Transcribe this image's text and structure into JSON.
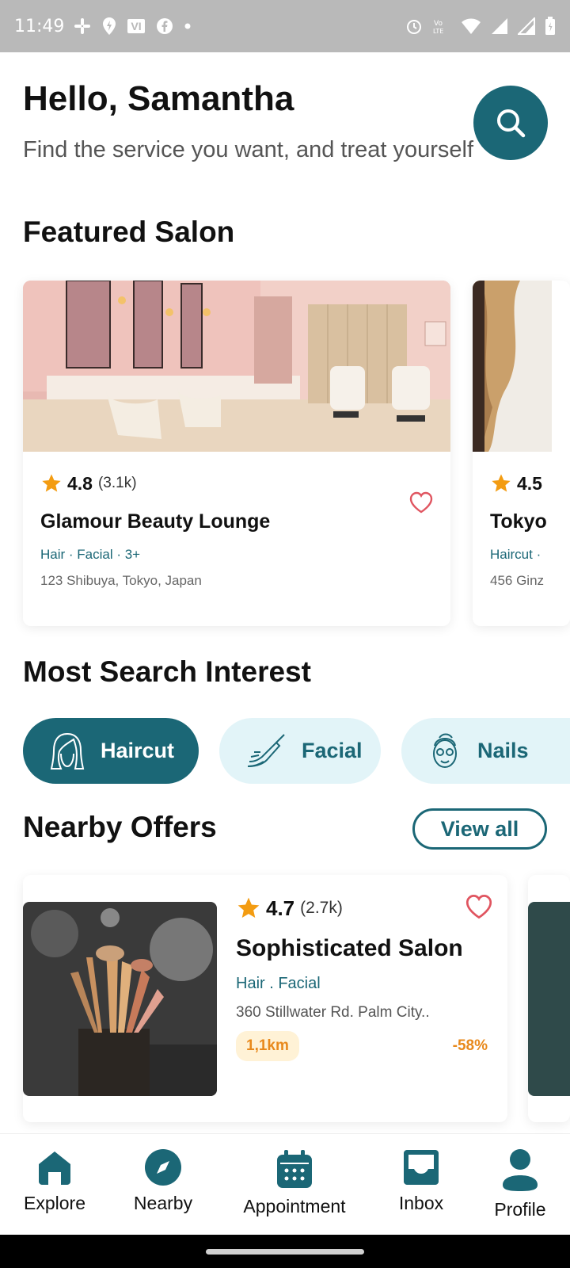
{
  "status_bar": {
    "time": "11:49",
    "left_icons": [
      "slack-icon",
      "location-icon",
      "vi-icon",
      "facebook-icon",
      "dot-icon"
    ],
    "vi_label": "VI",
    "right_icons": [
      "alarm-icon",
      "volte-icon",
      "wifi-icon",
      "signal-icon",
      "signal-icon",
      "battery-icon"
    ]
  },
  "header": {
    "greeting": "Hello, Samantha",
    "subtitle": "Find the service you want, and treat yourself",
    "search_icon": "search-icon"
  },
  "featured": {
    "title": "Featured Salon",
    "cards": [
      {
        "rating": "4.8",
        "count": "(3.1k)",
        "name": "Glamour Beauty Lounge",
        "tags": "Hair · Facial · 3+",
        "address": "123 Shibuya, Tokyo, Japan"
      },
      {
        "rating": "4.5",
        "name": "Tokyo",
        "tags": "Haircut ·",
        "address": "456 Ginz"
      }
    ]
  },
  "interest": {
    "title": "Most Search Interest",
    "chips": [
      {
        "label": "Haircut",
        "icon": "haircut-icon",
        "active": true
      },
      {
        "label": "Facial",
        "icon": "facial-icon",
        "active": false
      },
      {
        "label": "Nails",
        "icon": "nails-icon",
        "active": false
      }
    ]
  },
  "nearby": {
    "title": "Nearby Offers",
    "view_all": "View all",
    "offer": {
      "rating": "4.7",
      "count": "(2.7k)",
      "name": "Sophisticated Salon",
      "tags": "Hair . Facial",
      "address": "360 Stillwater Rd. Palm City..",
      "distance": "1,1km",
      "discount": "-58%"
    }
  },
  "nav": {
    "items": [
      {
        "label": "Explore",
        "icon": "home-icon"
      },
      {
        "label": "Nearby",
        "icon": "compass-icon"
      },
      {
        "label": "Appointment",
        "icon": "calendar-icon"
      },
      {
        "label": "Inbox",
        "icon": "inbox-icon"
      },
      {
        "label": "Profile",
        "icon": "profile-icon"
      }
    ]
  },
  "colors": {
    "primary": "#1b6776",
    "chip_bg": "#e2f4f8",
    "star": "#f39c12",
    "heart": "#e05560",
    "offer_accent": "#e8891c"
  }
}
